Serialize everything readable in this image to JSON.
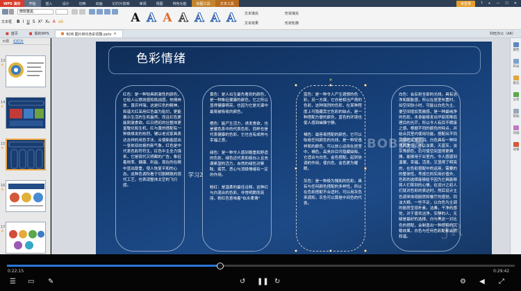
{
  "window": {
    "app_name": "WPS 演示",
    "menu_tabs": [
      "开始",
      "插入",
      "设计",
      "切换",
      "动画",
      "幻灯片放映",
      "审阅",
      "视图",
      "特色功能"
    ],
    "context_tabs": [
      "绘图工具",
      "文本工具"
    ],
    "login_label": "未登录",
    "right_controls": [
      "?",
      "∧",
      "—",
      "☐",
      "✕"
    ]
  },
  "ribbon": {
    "font_name": "微软雅黑",
    "text_outline": "文本框",
    "style_letters": [
      "A",
      "A",
      "A",
      "A",
      "A",
      "A",
      "A"
    ],
    "style_colors": [
      "#111111",
      "#2f64b3",
      "#e06a2b",
      "#444444",
      "#2f64b3",
      "#2f64b3",
      "#2f64b3"
    ],
    "fill_label": "文本填充",
    "effect_label": "文本效果",
    "shape_label": "形状填充",
    "outline_label": "形状轮廓"
  },
  "doc_tabs": {
    "tabs": [
      "首页",
      "我的WPS",
      "BOB 图片转化色彩调整.pptx"
    ],
    "right_label": "科旺办公（AR）"
  },
  "left_panel": {
    "tabs": [
      "大纲",
      "幻灯片"
    ],
    "slide_numbers": [
      "13",
      "14",
      "15",
      "16",
      "17",
      "18"
    ]
  },
  "slide": {
    "title": "色彩情绪",
    "cards": [
      {
        "paragraphs": [
          "红色：是一种较具刺激性的颜色，它给人以燃烧感和挑战感，热情奔放，喜庆祥瑞，这是红色的精神，和谐大红采用红色最为贴切，更能展示生活的生机盎然，而且红色更能刺激食欲。红日把初的壮整体更富敬化和生机，红与黄的搭配有一种焕焕发的热烈，辅以老式家具表达吉祥的用色手法，合使新能层出一张依双纹格的新气象，红色是中代表色彩符符生，红色中主全力强来，它是现代又明都的广告，象征着效率、健康、利益。现在的在精中显出厚重，使人恢复平和的心态。这种色调衔看于切割精致的现代工艺，也表现整体太空的飞行感。"
        ]
      },
      {
        "paragraphs": [
          "黄色：是人出生最先看到的颜色，是一种象征健康的颜色，它之所以显得健康明亮，也因为它是光谱中最易被吸收的颜色。",
          "橙色：能产生活力，诱发食欲，也是暖色系中的代表色彩，同样也是代表健康的色彩，它也含有成熟与幸福之意。",
          "绿色：是一种令人感到稳重和舒适的色彩，绿色还代表和极向上且充满希望的活力，自然的绿色对晕眩、疲劳、恶心与消极情绪有一定的作用。",
          "粉红：是温柔的最佳诠释，这种红与白混合的色彩，非常明朗而亮丽，粉红色意味着\"似水柔情\""
        ]
      },
      {
        "paragraphs": [
          "蓝色：是一种令人产生遐想的色彩，另一方面，它亦是相当严肃的色彩，这种强烈的色彩，在某种程度上可隐藏其它色彩的缺点，是一种搭配方便的颜色，蓝色的环境也使人感到幽雅宁静。",
          "褐色：最容易搭配的颜色，它可以吸收任何颜色的光线，是一种安逸祥和的颜色，可以放心运用在居室中。褐色，高贵并目可隐藏缺陷，它适合与白色、金色搭配，起到协调的作用，使白色、金色更为耀眼。",
          "灰色：是一种极为随和的色彩，具有与任何颜色搭配的多样性，所以在色彩搭配不合适时，可以用灰色来调和，灰色可以算是中间色的代表。"
        ]
      },
      {
        "paragraphs": [
          "白色：会反射全部的光线，具有洁净和膨胀感，所以在居室布置时，如空间较小时，可能以白色为主，便空间增加宽敞感，是一种最纯净的色彩，本身能够发出华丽而降低理目的光芒，所以令人有目不暇接之感。根据不同的颜色的特点，并结合其室内使用功能，搭配出不同风格的家居空间。白色具有一种特殊的美感，并以淡黄，天蓝灰，淡灰等颜色，仍可使空间显得更典雅，能够用于业室内，令人感感到温暖，幸福，活泼，又显得了明亮的，在色彩搭配中的运用，需要的的整体性，考虑它的实用价值外，色彩的选择能够给予因为它具能够将人们带到的心情，在设计之初人们就对色彩的表达时，然后设计主色调来体现厨房和餐厅的感觉。同淡大精，一些不足，以白色为主调的厨房呈现朴素，洁雅，干净的感觉，对于喜欢洁净，安静的人，无疑是最好的选择，白与黑这一对比色的搭配，会制造出一种很特的沉稳效果，白色与任何色彩配都会很和谐。"
        ]
      }
    ],
    "watermark": "BOB资源",
    "corner_mark": "JR",
    "floating_text": "学习2"
  },
  "right_sidebar": {
    "items": [
      "属性",
      "布局",
      "备忘",
      "分享",
      "帮助",
      "动画",
      "效果"
    ]
  },
  "player": {
    "current_time": "0:22:15",
    "total_time": "0:29:42",
    "progress": 0.42
  }
}
